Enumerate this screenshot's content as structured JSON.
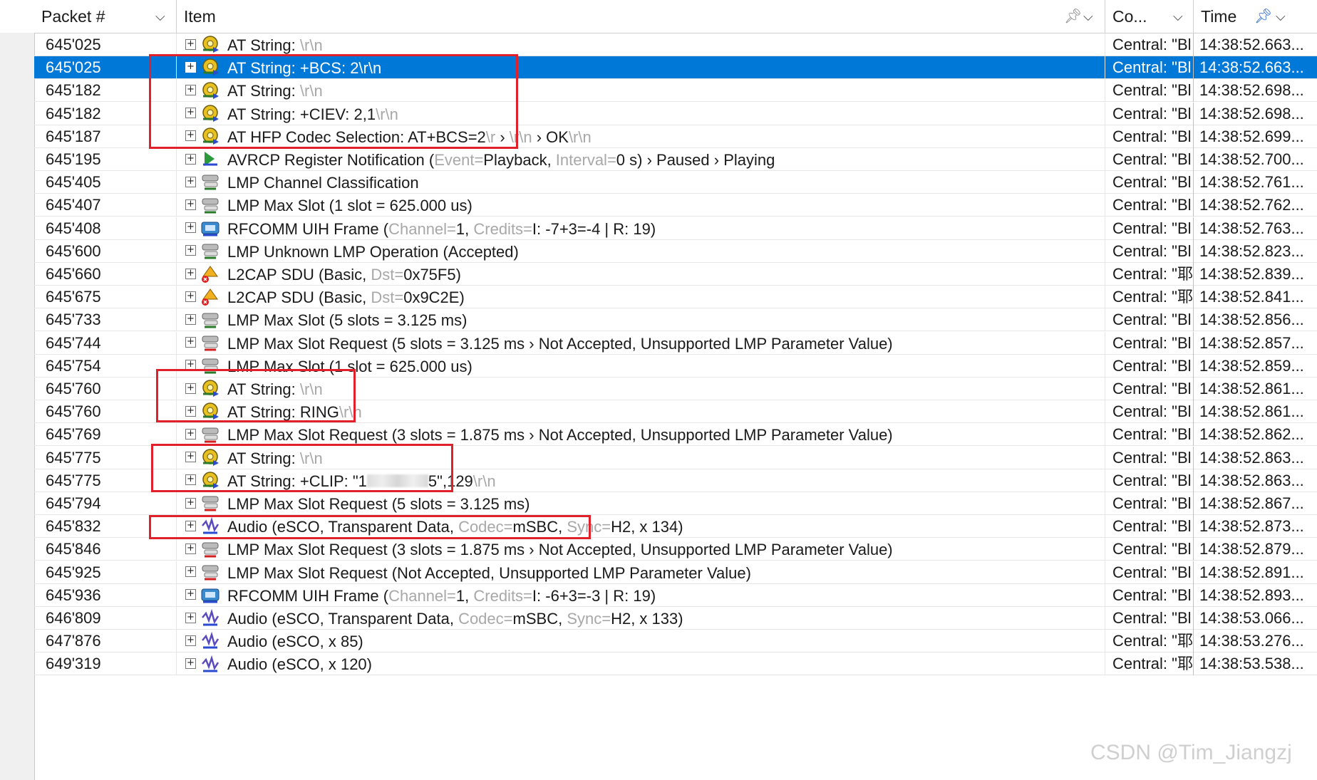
{
  "header": {
    "packet_label": "Packet #",
    "item_label": "Item",
    "co_label": "Co...",
    "time_label": "Time"
  },
  "rows": [
    {
      "packet": "645'025",
      "co": "Central: \"Bl",
      "time": "14:38:52.663...",
      "icon": "at-string-icon",
      "parts": [
        [
          "AT String: ",
          0
        ],
        [
          "\\r\\n",
          1
        ]
      ]
    },
    {
      "packet": "645'025",
      "co": "Central: \"Bl",
      "time": "14:38:52.663...",
      "icon": "at-string-icon",
      "selected": true,
      "parts": [
        [
          "AT String: +BCS: 2\\r\\n",
          0
        ]
      ]
    },
    {
      "packet": "645'182",
      "co": "Central: \"Bl",
      "time": "14:38:52.698...",
      "icon": "at-string-icon",
      "parts": [
        [
          "AT String: ",
          0
        ],
        [
          "\\r\\n",
          1
        ]
      ]
    },
    {
      "packet": "645'182",
      "co": "Central: \"Bl",
      "time": "14:38:52.698...",
      "icon": "at-string-icon",
      "parts": [
        [
          "AT String: +CIEV: 2,1",
          0
        ],
        [
          "\\r\\n",
          1
        ]
      ]
    },
    {
      "packet": "645'187",
      "co": "Central: \"Bl",
      "time": "14:38:52.699...",
      "icon": "at-codec-icon",
      "parts": [
        [
          "AT HFP Codec Selection: AT+BCS=2",
          0
        ],
        [
          "\\r",
          1
        ],
        [
          " › ",
          0
        ],
        [
          "\\r\\n",
          1
        ],
        [
          " › OK",
          0
        ],
        [
          "\\r\\n",
          1
        ]
      ]
    },
    {
      "packet": "645'195",
      "co": "Central: \"Bl",
      "time": "14:38:52.700...",
      "icon": "avrcp-icon",
      "parts": [
        [
          "AVRCP Register Notification (",
          0
        ],
        [
          "Event=",
          1
        ],
        [
          "Playback, ",
          0
        ],
        [
          "Interval=",
          1
        ],
        [
          "0 s) › Paused › Playing",
          0
        ]
      ]
    },
    {
      "packet": "645'405",
      "co": "Central: \"Bl",
      "time": "14:38:52.761...",
      "icon": "lmp-icon",
      "parts": [
        [
          "LMP Channel Classification",
          0
        ]
      ]
    },
    {
      "packet": "645'407",
      "co": "Central: \"Bl",
      "time": "14:38:52.762...",
      "icon": "lmp-icon",
      "parts": [
        [
          "LMP Max Slot (1 slot = 625.000 us)",
          0
        ]
      ]
    },
    {
      "packet": "645'408",
      "co": "Central: \"Bl",
      "time": "14:38:52.763...",
      "icon": "rfcomm-icon",
      "parts": [
        [
          "RFCOMM UIH Frame (",
          0
        ],
        [
          "Channel=",
          1
        ],
        [
          "1, ",
          0
        ],
        [
          "Credits=",
          1
        ],
        [
          "I: -7+3=-4 | R: 19)",
          0
        ]
      ]
    },
    {
      "packet": "645'600",
      "co": "Central: \"Bl",
      "time": "14:38:52.823...",
      "icon": "lmp-icon",
      "parts": [
        [
          "LMP Unknown LMP Operation (Accepted)",
          0
        ]
      ]
    },
    {
      "packet": "645'660",
      "co": "Central: \"耶",
      "time": "14:38:52.839...",
      "icon": "l2cap-icon",
      "parts": [
        [
          "L2CAP SDU (Basic, ",
          0
        ],
        [
          "Dst=",
          1
        ],
        [
          "0x75F5)",
          0
        ]
      ]
    },
    {
      "packet": "645'675",
      "co": "Central: \"耶",
      "time": "14:38:52.841...",
      "icon": "l2cap-icon",
      "parts": [
        [
          "L2CAP SDU (Basic, ",
          0
        ],
        [
          "Dst=",
          1
        ],
        [
          "0x9C2E)",
          0
        ]
      ]
    },
    {
      "packet": "645'733",
      "co": "Central: \"Bl",
      "time": "14:38:52.856...",
      "icon": "lmp-icon",
      "parts": [
        [
          "LMP Max Slot (5 slots = 3.125 ms)",
          0
        ]
      ]
    },
    {
      "packet": "645'744",
      "co": "Central: \"Bl",
      "time": "14:38:52.857...",
      "icon": "lmp-request-icon",
      "parts": [
        [
          "LMP Max Slot Request (5 slots = 3.125 ms › Not Accepted, Unsupported LMP Parameter Value)",
          0
        ]
      ]
    },
    {
      "packet": "645'754",
      "co": "Central: \"Bl",
      "time": "14:38:52.859...",
      "icon": "lmp-icon",
      "parts": [
        [
          "LMP Max Slot (1 slot = 625.000 us)",
          0
        ]
      ]
    },
    {
      "packet": "645'760",
      "co": "Central: \"Bl",
      "time": "14:38:52.861...",
      "icon": "at-string-icon",
      "parts": [
        [
          "AT String: ",
          0
        ],
        [
          "\\r\\n",
          1
        ]
      ]
    },
    {
      "packet": "645'760",
      "co": "Central: \"Bl",
      "time": "14:38:52.861...",
      "icon": "at-string-icon",
      "parts": [
        [
          "AT String: RING",
          0
        ],
        [
          "\\r\\n",
          1
        ]
      ]
    },
    {
      "packet": "645'769",
      "co": "Central: \"Bl",
      "time": "14:38:52.862...",
      "icon": "lmp-request-icon",
      "parts": [
        [
          "LMP Max Slot Request (3 slots = 1.875 ms › Not Accepted, Unsupported LMP Parameter Value)",
          0
        ]
      ]
    },
    {
      "packet": "645'775",
      "co": "Central: \"Bl",
      "time": "14:38:52.863...",
      "icon": "at-string-icon",
      "parts": [
        [
          "AT String: ",
          0
        ],
        [
          "\\r\\n",
          1
        ]
      ]
    },
    {
      "packet": "645'775",
      "co": "Central: \"Bl",
      "time": "14:38:52.863...",
      "icon": "at-string-icon",
      "parts": [
        [
          "AT String: +CLIP: \"1",
          0
        ],
        [
          "",
          2
        ],
        [
          "5\",129",
          0
        ],
        [
          "\\r\\n",
          1
        ]
      ]
    },
    {
      "packet": "645'794",
      "co": "Central: \"Bl",
      "time": "14:38:52.867...",
      "icon": "lmp-request-icon",
      "parts": [
        [
          "LMP Max Slot Request (5 slots = 3.125 ms)",
          0
        ]
      ]
    },
    {
      "packet": "645'832",
      "co": "Central: \"Bl",
      "time": "14:38:52.873...",
      "icon": "audio-icon",
      "parts": [
        [
          "Audio (eSCO, Transparent Data, ",
          0
        ],
        [
          "Codec=",
          1
        ],
        [
          "mSBC, ",
          0
        ],
        [
          "Sync=",
          1
        ],
        [
          "H2, x 134)",
          0
        ]
      ]
    },
    {
      "packet": "645'846",
      "co": "Central: \"Bl",
      "time": "14:38:52.879...",
      "icon": "lmp-request-icon",
      "parts": [
        [
          "LMP Max Slot Request (3 slots = 1.875 ms › Not Accepted, Unsupported LMP Parameter Value)",
          0
        ]
      ]
    },
    {
      "packet": "645'925",
      "co": "Central: \"Bl",
      "time": "14:38:52.891...",
      "icon": "lmp-request-icon",
      "parts": [
        [
          "LMP Max Slot Request (Not Accepted, Unsupported LMP Parameter Value)",
          0
        ]
      ]
    },
    {
      "packet": "645'936",
      "co": "Central: \"Bl",
      "time": "14:38:52.893...",
      "icon": "rfcomm-icon",
      "parts": [
        [
          "RFCOMM UIH Frame (",
          0
        ],
        [
          "Channel=",
          1
        ],
        [
          "1, ",
          0
        ],
        [
          "Credits=",
          1
        ],
        [
          "I: -6+3=-3 | R: 19)",
          0
        ]
      ]
    },
    {
      "packet": "646'809",
      "co": "Central: \"Bl",
      "time": "14:38:53.066...",
      "icon": "audio-icon",
      "parts": [
        [
          "Audio (eSCO, Transparent Data, ",
          0
        ],
        [
          "Codec=",
          1
        ],
        [
          "mSBC, ",
          0
        ],
        [
          "Sync=",
          1
        ],
        [
          "H2, x 133)",
          0
        ]
      ]
    },
    {
      "packet": "647'876",
      "co": "Central: \"耶",
      "time": "14:38:53.276...",
      "icon": "audio-icon",
      "parts": [
        [
          "Audio (eSCO, x 85)",
          0
        ]
      ]
    },
    {
      "packet": "649'319",
      "co": "Central: \"耶",
      "time": "14:38:53.538...",
      "icon": "audio-icon",
      "parts": [
        [
          "Audio (eSCO, x 120)",
          0
        ]
      ]
    }
  ],
  "watermark": "CSDN @Tim_Jiangzj",
  "colors": {
    "selected": "#0078d7",
    "highlight_box": "#e0202a",
    "dim_text": "#a8a8a8"
  }
}
